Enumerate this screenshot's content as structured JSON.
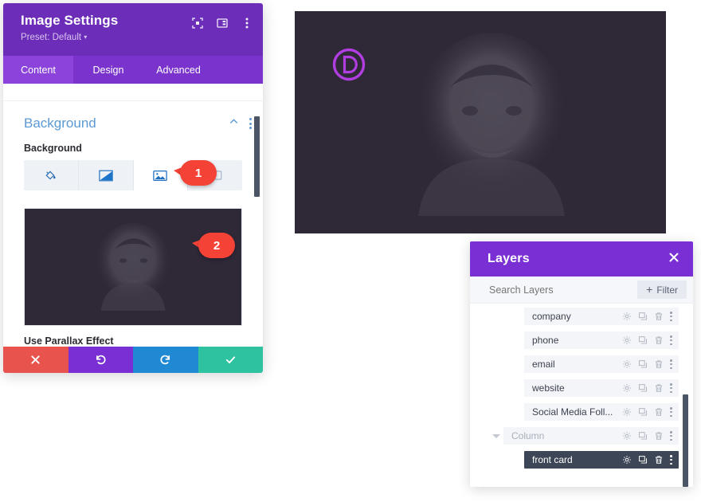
{
  "settings_modal": {
    "title": "Image Settings",
    "preset": "Preset: Default",
    "preset_caret": "▾",
    "header_icons": [
      {
        "name": "fullscreen-icon",
        "label": "Expand"
      },
      {
        "name": "panel-layout-icon",
        "label": "Layout"
      },
      {
        "name": "more-options-icon",
        "label": "More"
      }
    ],
    "tabs": [
      {
        "label": "Content",
        "active": true
      },
      {
        "label": "Design",
        "active": false
      },
      {
        "label": "Advanced",
        "active": false
      }
    ],
    "section": {
      "title": "Background",
      "collapse_icon": "chevron-up-icon",
      "options_icon": "more-options-icon"
    },
    "background_field_label": "Background",
    "background_types": [
      {
        "name": "background-color-tab",
        "icon": "paint-bucket-icon",
        "active": false
      },
      {
        "name": "background-gradient-tab",
        "icon": "gradient-icon",
        "active": false
      },
      {
        "name": "background-image-tab",
        "icon": "image-icon",
        "active": true
      },
      {
        "name": "background-video-tab",
        "icon": "video-icon",
        "active": false
      }
    ],
    "parallax_label": "Use Parallax Effect",
    "action_buttons": [
      {
        "name": "discard-button",
        "icon": "close-icon",
        "color": "#e8534e"
      },
      {
        "name": "undo-button",
        "icon": "undo-icon",
        "color": "#7a2fd4"
      },
      {
        "name": "redo-button",
        "icon": "redo-icon",
        "color": "#2089d4"
      },
      {
        "name": "save-button",
        "icon": "check-icon",
        "color": "#2ec2a0"
      }
    ],
    "header_color": "#6C2EB9",
    "tabs_color": "#7A33CC",
    "active_tab_color": "#8B43DB"
  },
  "callouts": [
    {
      "number": "1",
      "color": "#f44336"
    },
    {
      "number": "2",
      "color": "#f44336"
    }
  ],
  "canvas": {
    "logo_letter": "D",
    "logo_color": "#b13ee0",
    "background_color": "#2E2837"
  },
  "layers_panel": {
    "title": "Layers",
    "close_icon": "close-icon",
    "search_placeholder": "Search Layers",
    "search_value": "",
    "filter_label": "Filter",
    "header_color": "#7A2FD4",
    "rows": [
      {
        "label": "company",
        "depth": 3,
        "selected": false,
        "muted": false,
        "has_toggle": false
      },
      {
        "label": "phone",
        "depth": 3,
        "selected": false,
        "muted": false,
        "has_toggle": false
      },
      {
        "label": "email",
        "depth": 3,
        "selected": false,
        "muted": false,
        "has_toggle": false
      },
      {
        "label": "website",
        "depth": 3,
        "selected": false,
        "muted": false,
        "has_toggle": false
      },
      {
        "label": "Social Media Foll...",
        "depth": 3,
        "selected": false,
        "muted": false,
        "has_toggle": false
      },
      {
        "label": "Column",
        "depth": 2,
        "selected": false,
        "muted": true,
        "has_toggle": true
      },
      {
        "label": "front card",
        "depth": 3,
        "selected": true,
        "muted": false,
        "has_toggle": false
      }
    ],
    "row_icons": [
      {
        "name": "gear-icon"
      },
      {
        "name": "duplicate-icon"
      },
      {
        "name": "trash-icon"
      },
      {
        "name": "more-options-icon"
      }
    ]
  }
}
